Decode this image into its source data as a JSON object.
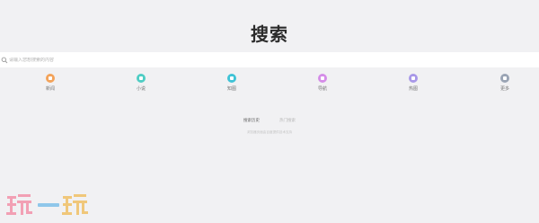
{
  "page": {
    "title": "搜索"
  },
  "search": {
    "placeholder": "请输入您想搜索的内容"
  },
  "categories": [
    {
      "label": "新闻",
      "icon": "news-icon",
      "color": "#f3a35a"
    },
    {
      "label": "小说",
      "icon": "book-icon",
      "color": "#4fcdc4"
    },
    {
      "label": "知图",
      "icon": "image-icon",
      "color": "#3fc3d6"
    },
    {
      "label": "导航",
      "icon": "compass-icon",
      "color": "#d58de8"
    },
    {
      "label": "热图",
      "icon": "picture-icon",
      "color": "#a898e8"
    },
    {
      "label": "更多",
      "icon": "more-icon",
      "color": "#9aa4b4"
    }
  ],
  "history": {
    "tab_active": "搜索历史",
    "tab_inactive": "热门搜索"
  },
  "footer": {
    "text": "浏览器页面由百度提供技术支持"
  },
  "watermark": {
    "text": "玩一玩",
    "colors": [
      "#f2a0b4",
      "#8fc7ea",
      "#f0c77a"
    ]
  }
}
